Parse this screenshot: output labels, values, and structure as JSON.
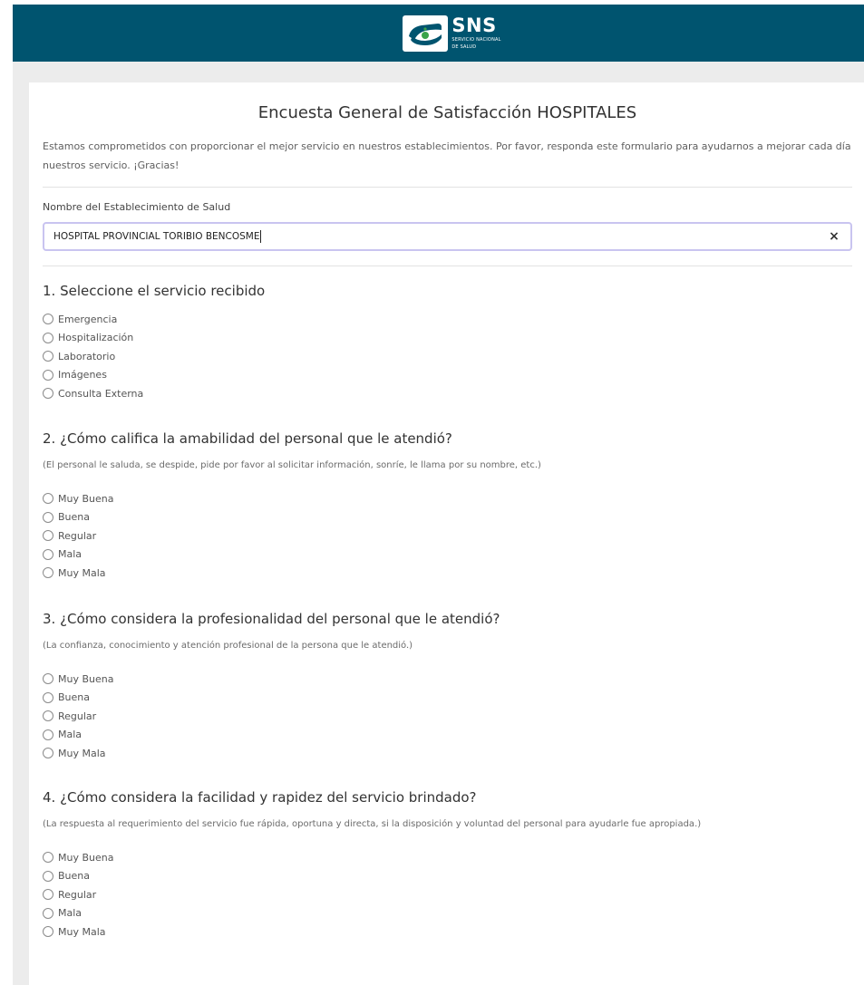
{
  "header": {
    "logo_title": "SNS",
    "logo_sub_1": "SERVICIO NACIONAL",
    "logo_sub_2": "DE SALUD",
    "bg_color": "#00546f"
  },
  "survey": {
    "title": "Encuesta General de Satisfacción HOSPITALES",
    "intro": "Estamos comprometidos con proporcionar el mejor servicio en nuestros establecimientos. Por favor, responda este formulario para ayudarnos a mejorar cada día nuestros servicio. ¡Gracias!"
  },
  "establishment": {
    "label": "Nombre del Establecimiento de Salud",
    "value": "HOSPITAL PROVINCIAL TORIBIO BENCOSME",
    "clear_icon": "×"
  },
  "questions": [
    {
      "title": "1. Seleccione el servicio recibido",
      "hint": "",
      "options": [
        "Emergencia",
        "Hospitalización",
        "Laboratorio",
        "Imágenes",
        "Consulta Externa"
      ]
    },
    {
      "title": "2. ¿Cómo califica la amabilidad del personal que le atendió?",
      "hint": "(El personal le saluda, se despide, pide por favor al solicitar información, sonríe, le llama por su nombre, etc.)",
      "options": [
        "Muy Buena",
        "Buena",
        "Regular",
        "Mala",
        "Muy Mala"
      ]
    },
    {
      "title": "3. ¿Cómo considera la profesionalidad del personal que le atendió?",
      "hint": "(La confianza, conocimiento y atención profesional de la persona que le atendió.)",
      "options": [
        "Muy Buena",
        "Buena",
        "Regular",
        "Mala",
        "Muy Mala"
      ]
    },
    {
      "title": "4. ¿Cómo considera la facilidad y rapidez del servicio brindado?",
      "hint": "(La respuesta al requerimiento del servicio fue rápida, oportuna y directa, si la disposición y voluntad del personal para ayudarle fue apropiada.)",
      "options": [
        "Muy Buena",
        "Buena",
        "Regular",
        "Mala",
        "Muy Mala"
      ]
    }
  ]
}
